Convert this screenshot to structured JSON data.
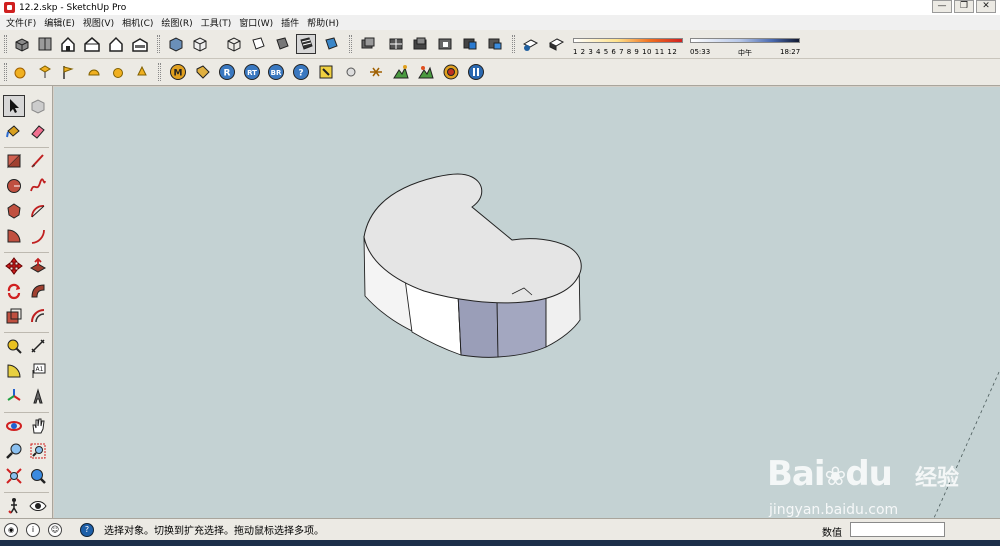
{
  "window": {
    "title": "12.2.skp - SketchUp Pro",
    "min_glyph": "—",
    "max_glyph": "❐",
    "close_glyph": "✕"
  },
  "menu": [
    {
      "label": "文件(F)"
    },
    {
      "label": "编辑(E)"
    },
    {
      "label": "视图(V)"
    },
    {
      "label": "相机(C)"
    },
    {
      "label": "绘图(R)"
    },
    {
      "label": "工具(T)"
    },
    {
      "label": "窗口(W)"
    },
    {
      "label": "插件"
    },
    {
      "label": "帮助(H)"
    }
  ],
  "shadow_settings": {
    "months_ticks": "1 2 3 4 5 6 7 8 9 10 11 12",
    "time_start": "05:33",
    "time_mid": "中午",
    "time_end": "18:27"
  },
  "toolbar2_icons": [
    "M",
    "R",
    "RT",
    "BR",
    "?"
  ],
  "status": {
    "hint": "选择对象。切换到扩充选择。拖动鼠标选择多项。",
    "vcb_label": "数值",
    "vcb_value": ""
  },
  "watermark": {
    "brand": "Bai",
    "brand2": "du",
    "product": "经验",
    "url": "jingyan.baidu.com"
  },
  "colors": {
    "viewport_bg": "#c4d2d3",
    "model_top": "#e4e4e4",
    "model_side_light": "#f8f8f8",
    "model_side_shaded": "#9a9eb8",
    "toolbar_bg": "#eceae4"
  }
}
